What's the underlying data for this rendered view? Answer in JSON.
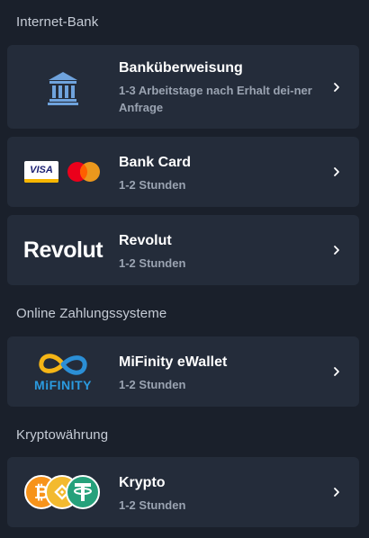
{
  "sections": {
    "internet_bank": "Internet-Bank",
    "online_payment": "Online Zahlungssysteme",
    "crypto": "Kryptowährung"
  },
  "methods": [
    {
      "title": "Banküberweisung",
      "subtitle": "1-3 Arbeitstage nach Erhalt dei-ner Anfrage",
      "icon": "bank-building-icon"
    },
    {
      "title": "Bank Card",
      "subtitle": "1-2 Stunden",
      "icon": "visa-mastercard-logos"
    },
    {
      "title": "Revolut",
      "subtitle": "1-2 Stunden",
      "icon": "revolut-logo",
      "logo_text": "Revolut"
    },
    {
      "title": "MiFinity eWallet",
      "subtitle": "1-2 Stunden",
      "icon": "mifinity-logo",
      "logo_text": "MiFINITY"
    },
    {
      "title": "Krypto",
      "subtitle": "1-2 Stunden",
      "icon": "crypto-coins-icon"
    }
  ],
  "visa_text": "VISA",
  "colors": {
    "background": "#1a202b",
    "card": "#242c3a",
    "section_text": "#c6ccd6",
    "subtitle_text": "#9aa3b1",
    "bank_icon": "#6fa3dd",
    "mastercard_red": "#eb001b",
    "mastercard_yellow": "#f79e1b",
    "bitcoin": "#f7931a",
    "binance": "#f3ba2f",
    "tether": "#26a17b"
  }
}
